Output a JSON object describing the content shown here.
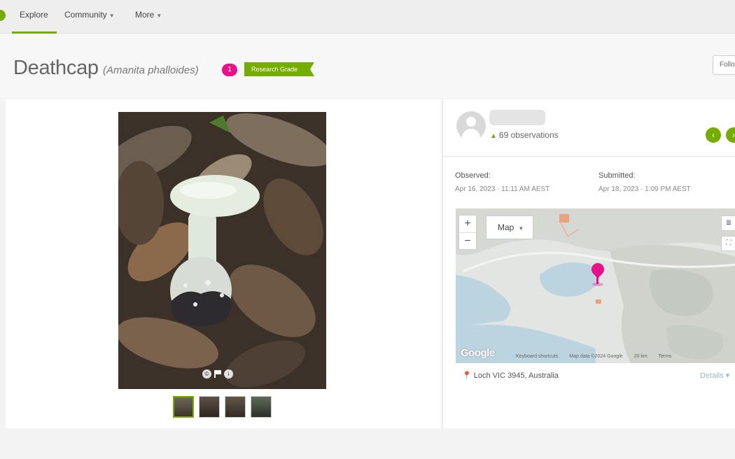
{
  "nav": {
    "items": [
      {
        "label": "Explore"
      },
      {
        "label": "Community"
      },
      {
        "label": "More"
      }
    ]
  },
  "header": {
    "common_name": "Deathcap",
    "scientific_name": "(Amanita phalloides)",
    "count_badge": "1",
    "quality_badge": "Research Grade",
    "follow_label": "Follo"
  },
  "photo": {
    "thumbnail_count": 4,
    "active_thumbnail": 1
  },
  "observer": {
    "observations_label": "69 observations"
  },
  "meta": {
    "observed_label": "Observed:",
    "observed_value": "Apr 16, 2023 · 11:11 AM AEST",
    "submitted_label": "Submitted:",
    "submitted_value": "Apr 18, 2023 · 1:09 PM AEST"
  },
  "map": {
    "type_label": "Map",
    "logo": "Google",
    "footer": {
      "shortcuts": "Keyboard shortcuts",
      "data": "Map data ©2024 Google",
      "scale": "20 km",
      "terms": "Terms"
    }
  },
  "location": {
    "place": "Loch VIC 3945, Australia",
    "details_label": "Details"
  },
  "colors": {
    "brand_green": "#74ac00",
    "accent_pink": "#e8118a"
  }
}
